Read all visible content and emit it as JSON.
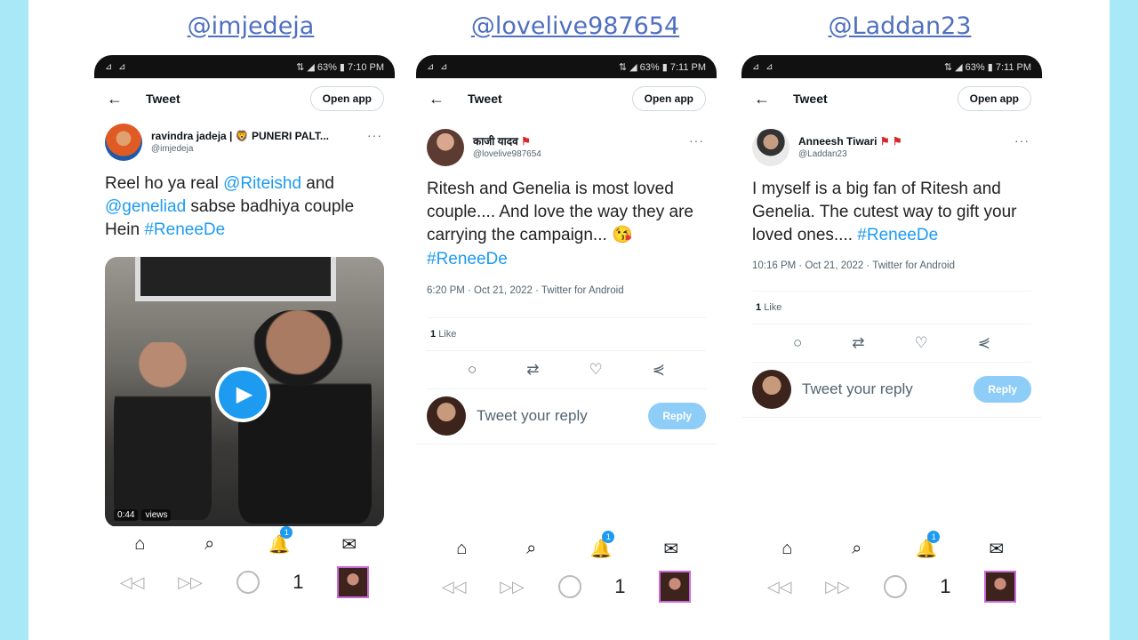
{
  "handles": [
    "@imjedeja",
    "@lovelive987654",
    "@Laddan23"
  ],
  "phones": [
    {
      "status": {
        "left": "⊿ ⊿",
        "right": "⇅ ◢ 63% ▮ 7:10 PM"
      },
      "header": {
        "back": "←",
        "title": "Tweet",
        "open_app": "Open app"
      },
      "author": {
        "name": "ravindra jadeja | 🦁 PUNERI PALT...",
        "username": "@imjedeja"
      },
      "text_parts": [
        "Reel ho ya real ",
        "@Riteishd",
        " and ",
        "@geneliad",
        " sabse badhiya couple Hein  ",
        "#ReneeDe"
      ],
      "video": {
        "duration": "0:44",
        "views": "views"
      },
      "nav": {
        "home": "⌂",
        "search": "⌕",
        "bell": "🔔",
        "badge": "1",
        "mail": "✉"
      },
      "sys": {
        "back": "◁◁",
        "fwd": "▷▷",
        "page": "1"
      }
    },
    {
      "status": {
        "left": "⊿ ⊿",
        "right": "⇅ ◢ 63% ▮ 7:11 PM"
      },
      "header": {
        "back": "←",
        "title": "Tweet",
        "open_app": "Open app"
      },
      "author": {
        "name": "काजी यादव",
        "username": "@lovelive987654",
        "flag": "⚑"
      },
      "text_parts": [
        "Ritesh and Genelia is most loved couple.... And love the way they are carrying the campaign... 😘 ",
        "#ReneeDe"
      ],
      "meta": "6:20 PM · Oct 21, 2022 · Twitter for Android",
      "likes": {
        "count": "1",
        "label": "Like"
      },
      "reply": {
        "placeholder": "Tweet your reply",
        "button": "Reply"
      },
      "nav": {
        "home": "⌂",
        "search": "⌕",
        "bell": "🔔",
        "badge": "1",
        "mail": "✉"
      },
      "sys": {
        "back": "◁◁",
        "fwd": "▷▷",
        "page": "1"
      }
    },
    {
      "status": {
        "left": "⊿ ⊿",
        "right": "⇅ ◢ 63% ▮ 7:11 PM"
      },
      "header": {
        "back": "←",
        "title": "Tweet",
        "open_app": "Open app"
      },
      "author": {
        "name": "Anneesh Tiwari",
        "username": "@Laddan23",
        "flag": "⚑ ⚑"
      },
      "text_parts": [
        "I myself is a big fan of Ritesh and Genelia. The cutest way to gift your loved ones.... ",
        "#ReneeDe"
      ],
      "meta": "10:16 PM · Oct 21, 2022 · Twitter for Android",
      "likes": {
        "count": "1",
        "label": "Like"
      },
      "reply": {
        "placeholder": "Tweet your reply",
        "button": "Reply"
      },
      "nav": {
        "home": "⌂",
        "search": "⌕",
        "bell": "🔔",
        "badge": "1",
        "mail": "✉"
      },
      "sys": {
        "back": "◁◁",
        "fwd": "▷▷",
        "page": "1"
      }
    }
  ],
  "action_icons": {
    "reply": "○",
    "retweet": "⇄",
    "like": "♡",
    "share": "⋞"
  },
  "more_icon": "···",
  "colors": {
    "link": "#1d9bf0",
    "handle": "#4f6fc0",
    "bg": "#a9e8f7"
  }
}
